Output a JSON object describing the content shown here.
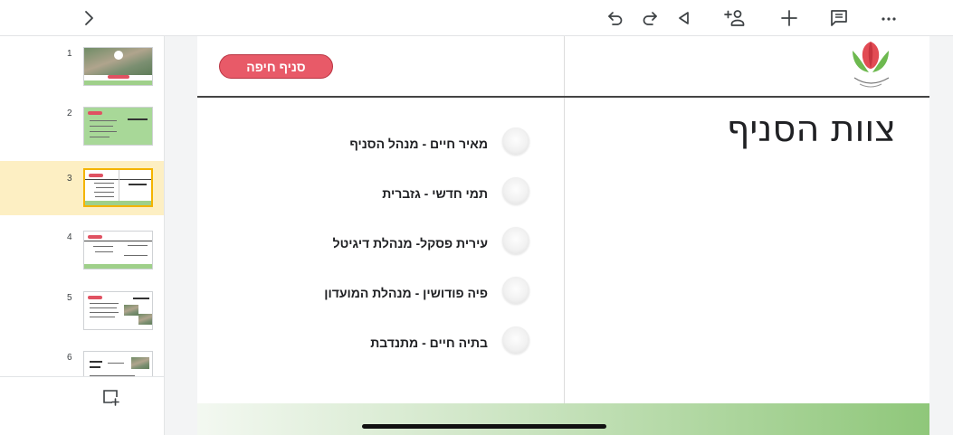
{
  "toolbar": {
    "icons": [
      "chevron-right-icon",
      "undo-icon",
      "redo-icon",
      "present-icon",
      "add-person-icon",
      "plus-icon",
      "speaker-notes-icon",
      "more-icon"
    ]
  },
  "filmstrip": {
    "slides": [
      {
        "number": "1",
        "selected": false
      },
      {
        "number": "2",
        "selected": false
      },
      {
        "number": "3",
        "selected": true
      },
      {
        "number": "4",
        "selected": false
      },
      {
        "number": "5",
        "selected": false
      },
      {
        "number": "6",
        "selected": false
      }
    ]
  },
  "slide": {
    "branch_label": "סניף חיפה",
    "title": "צוות הסניף",
    "team": [
      "מאיר חיים - מנהל הסניף",
      "תמי חדשי - גזברית",
      "עירית פסקל- מנהלת דיגיטל",
      "פיה פודושין - מנהלת המועדון",
      "בתיה חיים - מתנדבת"
    ]
  },
  "colors": {
    "pill": "#e85a68",
    "band_green": "#8fc77a",
    "selected_thumb": "#fdefc3"
  }
}
